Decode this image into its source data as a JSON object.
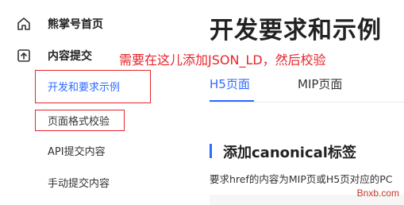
{
  "sidebar": {
    "home": {
      "label": "熊掌号首页",
      "icon": "home-icon"
    },
    "content_submit": {
      "label": "内容提交",
      "icon": "upload-icon"
    },
    "sub_items": [
      {
        "label": "开发和要求示例",
        "active": true
      },
      {
        "label": "页面格式校验",
        "active": false
      },
      {
        "label": "API提交内容",
        "active": false
      },
      {
        "label": "手动提交内容",
        "active": false
      }
    ]
  },
  "main": {
    "title": "开发要求和示例",
    "annotation": "需要在这儿添加JSON_LD，然后校验",
    "tabs": [
      {
        "label": "H5页面",
        "active": true
      },
      {
        "label": "MIP页面",
        "active": false
      }
    ],
    "section_title": "添加canonical标签",
    "description": "要求href的内容为MIP页或H5页对应的PC"
  },
  "watermark": "Bnxb.com",
  "colors": {
    "accent": "#2f6bff",
    "annotation": "#e8232a"
  }
}
